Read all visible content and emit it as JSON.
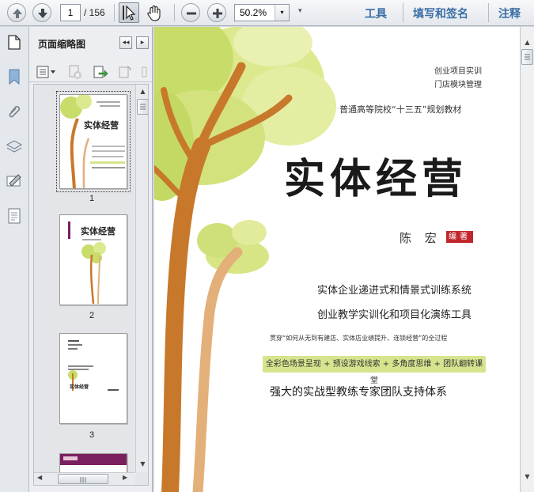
{
  "toolbar": {
    "current_page": "1",
    "total_pages": "/ 156",
    "zoom": "50.2%",
    "zoom_dropdown_glyph": "▾",
    "more_glyph": "▾",
    "links": [
      "工具",
      "填写和签名",
      "注释"
    ]
  },
  "panel": {
    "title": "页面缩略图",
    "collapse_glyph": "◂◂",
    "expand_glyph": "▸",
    "thumbnails": [
      {
        "label": "1",
        "title": "实体经营"
      },
      {
        "label": "2",
        "title": "实体经营"
      },
      {
        "label": "3",
        "title": "实体经营"
      }
    ]
  },
  "cover": {
    "series_line1": "创业项目实训",
    "series_line2": "门店模块管理",
    "series_main": "普通高等院校“十三五”规划教材",
    "title": "实体经营",
    "author": "陈 宏",
    "author_role": "编著",
    "tagline1": "实体企业递进式和情景式训练系统",
    "tagline2": "创业教学实训化和项目化演练工具",
    "small_line": "贯穿“如何从无到有建店、实体店业绩提升、连锁经营”的全过程",
    "green_bar": "全彩色场景呈现 + 预设游戏线索 + 多角度思维 + 团队翻转课堂",
    "bottom_line": "强大的实战型教练专家团队支持体系"
  },
  "colors": {
    "accent_blue": "#3a6ea5",
    "tree_brown": "#c8782a",
    "tree_light": "#e3b07a",
    "leaf_green": "#c8dc6a",
    "badge_red": "#c0272d"
  }
}
